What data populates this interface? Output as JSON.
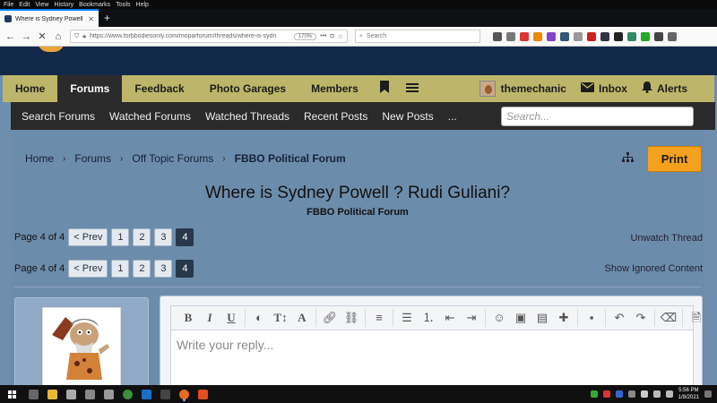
{
  "browser": {
    "menu": [
      "File",
      "Edit",
      "View",
      "History",
      "Bookmarks",
      "Tools",
      "Help"
    ],
    "tab_title": "Where is Sydney Powell ? Rudi G",
    "new_tab": "+",
    "url": "https://www.forbbodiesonly.com/moparforum/threads/where-is-sydn",
    "zoom": "170%",
    "search_placeholder": "Search"
  },
  "nav": {
    "items": [
      "Home",
      "Forums",
      "Feedback",
      "Photo Garages",
      "Members"
    ],
    "active_index": 1,
    "username": "themechanic",
    "inbox": "Inbox",
    "alerts": "Alerts"
  },
  "subnav": {
    "items": [
      "Search Forums",
      "Watched Forums",
      "Watched Threads",
      "Recent Posts",
      "New Posts",
      "..."
    ],
    "search_placeholder": "Search..."
  },
  "breadcrumb": {
    "items": [
      "Home",
      "Forums",
      "Off Topic Forums"
    ],
    "current": "FBBO Political Forum"
  },
  "print_label": "Print",
  "thread": {
    "title": "Where is Sydney Powell ? Rudi Guliani?",
    "forum": "FBBO Political Forum"
  },
  "pagination": {
    "label": "Page 4 of 4",
    "prev": "< Prev",
    "pages": [
      "1",
      "2",
      "3",
      "4"
    ],
    "current": "4"
  },
  "links": {
    "unwatch": "Unwatch Thread",
    "show_ignored": "Show Ignored Content"
  },
  "editor": {
    "placeholder": "Write your reply..."
  },
  "taskbar": {
    "time": "5:56 PM",
    "date": "1/9/2021"
  },
  "colors": {
    "nav_bar": "#bdb66a",
    "page_bg": "#6f8eae",
    "banner": "#12294a",
    "print_button": "#f5a11e",
    "current_page": "#28384c"
  }
}
